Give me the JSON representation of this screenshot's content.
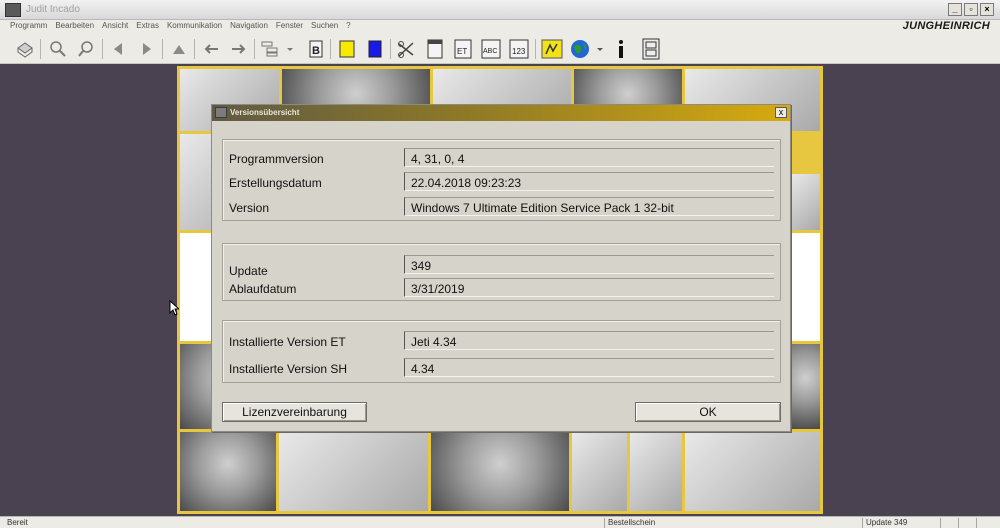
{
  "window": {
    "title": "Judit Incado"
  },
  "menu": {
    "items": [
      "Programm",
      "Bearbeiten",
      "Ansicht",
      "Extras",
      "Kommunikation",
      "Navigation",
      "Fenster",
      "Suchen",
      "?"
    ]
  },
  "brand": "JUNGHEINRICH",
  "toolbar": {
    "icons": [
      "print-icon",
      "zoom-in-icon",
      "zoom-out-icon",
      "back-icon",
      "forward-icon",
      "up-icon",
      "arrow-left-icon",
      "arrow-right-icon",
      "tree-icon",
      "bookmark-icon",
      "yellow-square-icon",
      "blue-square-icon",
      "scissors-icon",
      "document-icon",
      "et-icon",
      "abc-icon",
      "123-icon",
      "hand-icon",
      "globe-icon",
      "info-icon",
      "cabinet-icon"
    ],
    "colors": {
      "yellow": "#f7ea00",
      "blue": "#1a1ae6"
    }
  },
  "dialog": {
    "title": "Versionsübersicht",
    "close_label": "x",
    "group1": [
      {
        "label": "Programmversion",
        "value": "4, 31, 0, 4"
      },
      {
        "label": "Erstellungsdatum",
        "value": "22.04.2018 09:23:23"
      },
      {
        "label": "Version",
        "value": "Windows 7 Ultimate Edition Service Pack 1 32-bit"
      }
    ],
    "group2": [
      {
        "label": "Update",
        "value": "349"
      },
      {
        "label": "Ablaufdatum",
        "value": "3/31/2019"
      }
    ],
    "group3": [
      {
        "label": "Installierte Version ET",
        "value": "Jeti 4.34"
      },
      {
        "label": "Installierte Version SH",
        "value": "4.34"
      }
    ],
    "license_button": "Lizenzvereinbarung",
    "ok_button": "OK"
  },
  "statusbar": {
    "left": "Bereit",
    "middle": "Bestellschein",
    "right": "Update 349"
  },
  "colors": {
    "background": "#4a4251",
    "mosaic_frame": "#e7c640",
    "dialog_face": "#d6d3ca"
  }
}
